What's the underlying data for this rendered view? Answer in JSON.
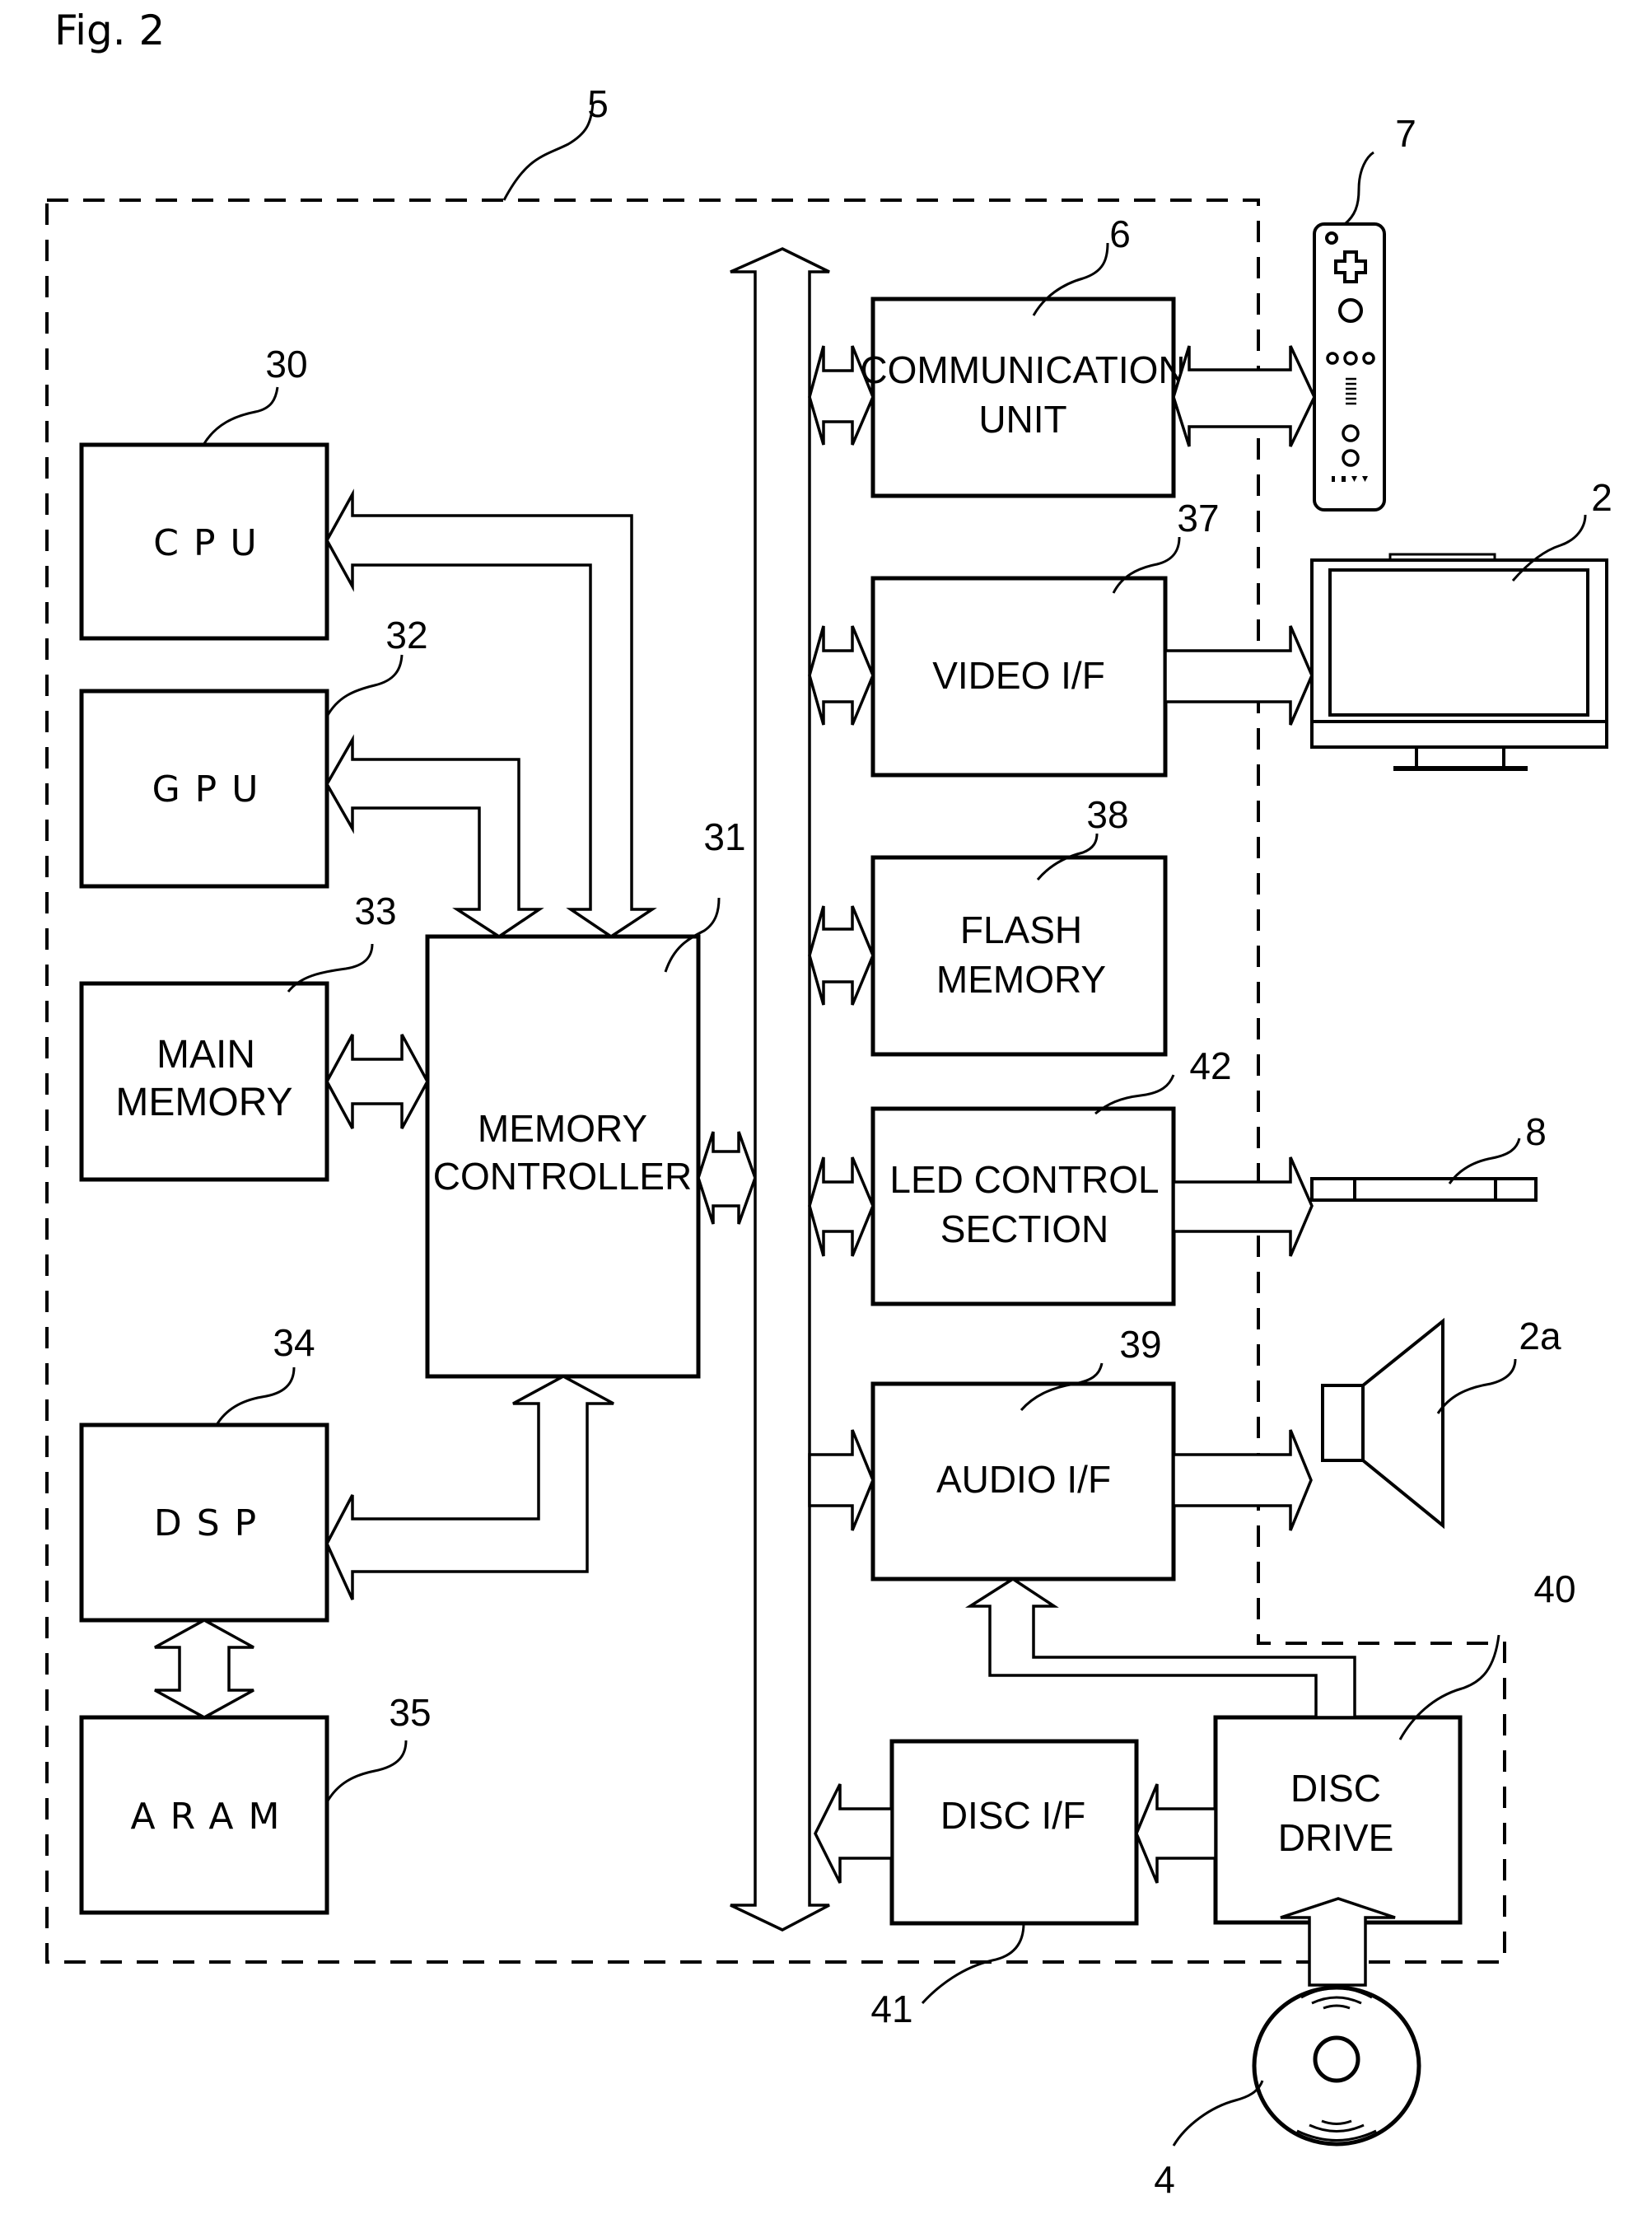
{
  "figure": {
    "title": "Fig. 2"
  },
  "refs": {
    "system": "5",
    "cpu": "30",
    "memory_controller": "31",
    "gpu": "32",
    "main_memory": "33",
    "dsp": "34",
    "aram": "35",
    "communication_unit": "6",
    "video_if": "37",
    "flash_memory": "38",
    "led_control": "42",
    "audio_if": "39",
    "disc_drive": "40",
    "disc_if": "41",
    "controller": "7",
    "television": "2",
    "marker": "8",
    "speaker": "2a",
    "optical_disc": "4"
  },
  "blocks": {
    "cpu": [
      "CPU"
    ],
    "gpu": [
      "GPU"
    ],
    "main_memory": [
      "MAIN",
      "MEMORY"
    ],
    "memory_controller": [
      "MEMORY",
      "CONTROLLER"
    ],
    "dsp": [
      "DSP"
    ],
    "aram": [
      "ARAM"
    ],
    "communication_unit": [
      "COMMUNICATION",
      "UNIT"
    ],
    "video_if": [
      "VIDEO I/F"
    ],
    "flash_memory": [
      "FLASH",
      "MEMORY"
    ],
    "led_control": [
      "LED CONTROL",
      "SECTION"
    ],
    "audio_if": [
      "AUDIO I/F"
    ],
    "disc_if": [
      "DISC I/F"
    ],
    "disc_drive": [
      "DISC",
      "DRIVE"
    ]
  },
  "external_devices": [
    "controller",
    "television",
    "marker",
    "speaker",
    "optical-disc"
  ],
  "connections": [
    {
      "from": "memory_controller",
      "to": "cpu",
      "kind": "one-way"
    },
    {
      "from": "memory_controller",
      "to": "gpu",
      "kind": "one-way-and-back"
    },
    {
      "from": "main_memory",
      "to": "memory_controller",
      "kind": "bidirectional"
    },
    {
      "from": "memory_controller",
      "to": "dsp",
      "kind": "bidirectional"
    },
    {
      "from": "dsp",
      "to": "aram",
      "kind": "bidirectional"
    },
    {
      "from": "memory_controller",
      "to": "bus",
      "kind": "bidirectional"
    },
    {
      "from": "bus",
      "to": "communication_unit",
      "kind": "bidirectional"
    },
    {
      "from": "communication_unit",
      "to": "controller",
      "kind": "bidirectional"
    },
    {
      "from": "bus",
      "to": "video_if",
      "kind": "bidirectional"
    },
    {
      "from": "video_if",
      "to": "television",
      "kind": "one-way"
    },
    {
      "from": "bus",
      "to": "flash_memory",
      "kind": "bidirectional"
    },
    {
      "from": "bus",
      "to": "led_control",
      "kind": "bidirectional"
    },
    {
      "from": "led_control",
      "to": "marker",
      "kind": "one-way"
    },
    {
      "from": "bus",
      "to": "audio_if",
      "kind": "one-way"
    },
    {
      "from": "audio_if",
      "to": "speaker",
      "kind": "one-way"
    },
    {
      "from": "disc_drive",
      "to": "audio_if",
      "kind": "one-way"
    },
    {
      "from": "disc_drive",
      "to": "disc_if",
      "kind": "one-way"
    },
    {
      "from": "disc_if",
      "to": "bus",
      "kind": "one-way"
    },
    {
      "from": "optical_disc",
      "to": "disc_drive",
      "kind": "one-way"
    }
  ]
}
